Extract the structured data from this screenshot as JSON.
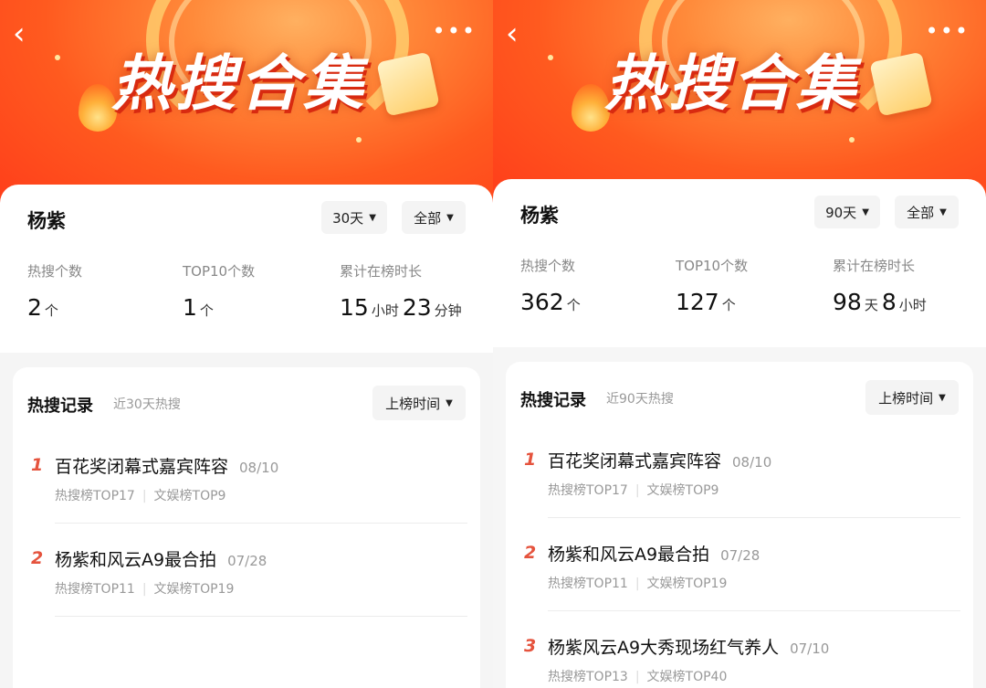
{
  "banner": {
    "title": "热搜合集",
    "back_icon": "chevron-left-icon",
    "more_icon": "more-dots-icon"
  },
  "panels": [
    {
      "name": "杨紫",
      "period_filter": "30天",
      "category_filter": "全部",
      "stats": {
        "hot_count_label": "热搜个数",
        "hot_count_value": "2",
        "hot_count_unit": "个",
        "top10_label": "TOP10个数",
        "top10_value": "1",
        "top10_unit": "个",
        "duration_label": "累计在榜时长",
        "duration_v1": "15",
        "duration_u1": "小时",
        "duration_v2": "23",
        "duration_u2": "分钟"
      },
      "records": {
        "title": "热搜记录",
        "subtitle": "近30天热搜",
        "sort_label": "上榜时间",
        "items": [
          {
            "rank": "1",
            "title": "百花奖闭幕式嘉宾阵容",
            "date": "08/10",
            "tag1": "热搜榜TOP17",
            "tag2": "文娱榜TOP9"
          },
          {
            "rank": "2",
            "title": "杨紫和风云A9最合拍",
            "date": "07/28",
            "tag1": "热搜榜TOP11",
            "tag2": "文娱榜TOP19"
          }
        ]
      }
    },
    {
      "name": "杨紫",
      "period_filter": "90天",
      "category_filter": "全部",
      "stats": {
        "hot_count_label": "热搜个数",
        "hot_count_value": "362",
        "hot_count_unit": "个",
        "top10_label": "TOP10个数",
        "top10_value": "127",
        "top10_unit": "个",
        "duration_label": "累计在榜时长",
        "duration_v1": "98",
        "duration_u1": "天",
        "duration_v2": "8",
        "duration_u2": "小时"
      },
      "records": {
        "title": "热搜记录",
        "subtitle": "近90天热搜",
        "sort_label": "上榜时间",
        "items": [
          {
            "rank": "1",
            "title": "百花奖闭幕式嘉宾阵容",
            "date": "08/10",
            "tag1": "热搜榜TOP17",
            "tag2": "文娱榜TOP9"
          },
          {
            "rank": "2",
            "title": "杨紫和风云A9最合拍",
            "date": "07/28",
            "tag1": "热搜榜TOP11",
            "tag2": "文娱榜TOP19"
          },
          {
            "rank": "3",
            "title": "杨紫风云A9大秀现场红气养人",
            "date": "07/10",
            "tag1": "热搜榜TOP13",
            "tag2": "文娱榜TOP40"
          }
        ]
      }
    }
  ]
}
